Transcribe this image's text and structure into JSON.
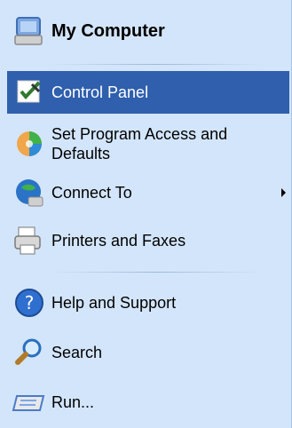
{
  "menu": {
    "header": {
      "label": "My Computer"
    },
    "items": [
      {
        "label": "Control Panel"
      },
      {
        "label": "Set Program Access and Defaults"
      },
      {
        "label": "Connect To"
      },
      {
        "label": "Printers and Faxes"
      },
      {
        "label": "Help and Support"
      },
      {
        "label": "Search"
      },
      {
        "label": "Run..."
      }
    ]
  },
  "colors": {
    "panel_bg": "#d3e5fa",
    "selected_bg": "#2f5fad",
    "selected_text": "#ffffff"
  },
  "icons": [
    "my-computer-icon",
    "control-panel-icon",
    "program-access-icon",
    "connect-to-icon",
    "printers-faxes-icon",
    "help-support-icon",
    "search-icon",
    "run-icon"
  ]
}
